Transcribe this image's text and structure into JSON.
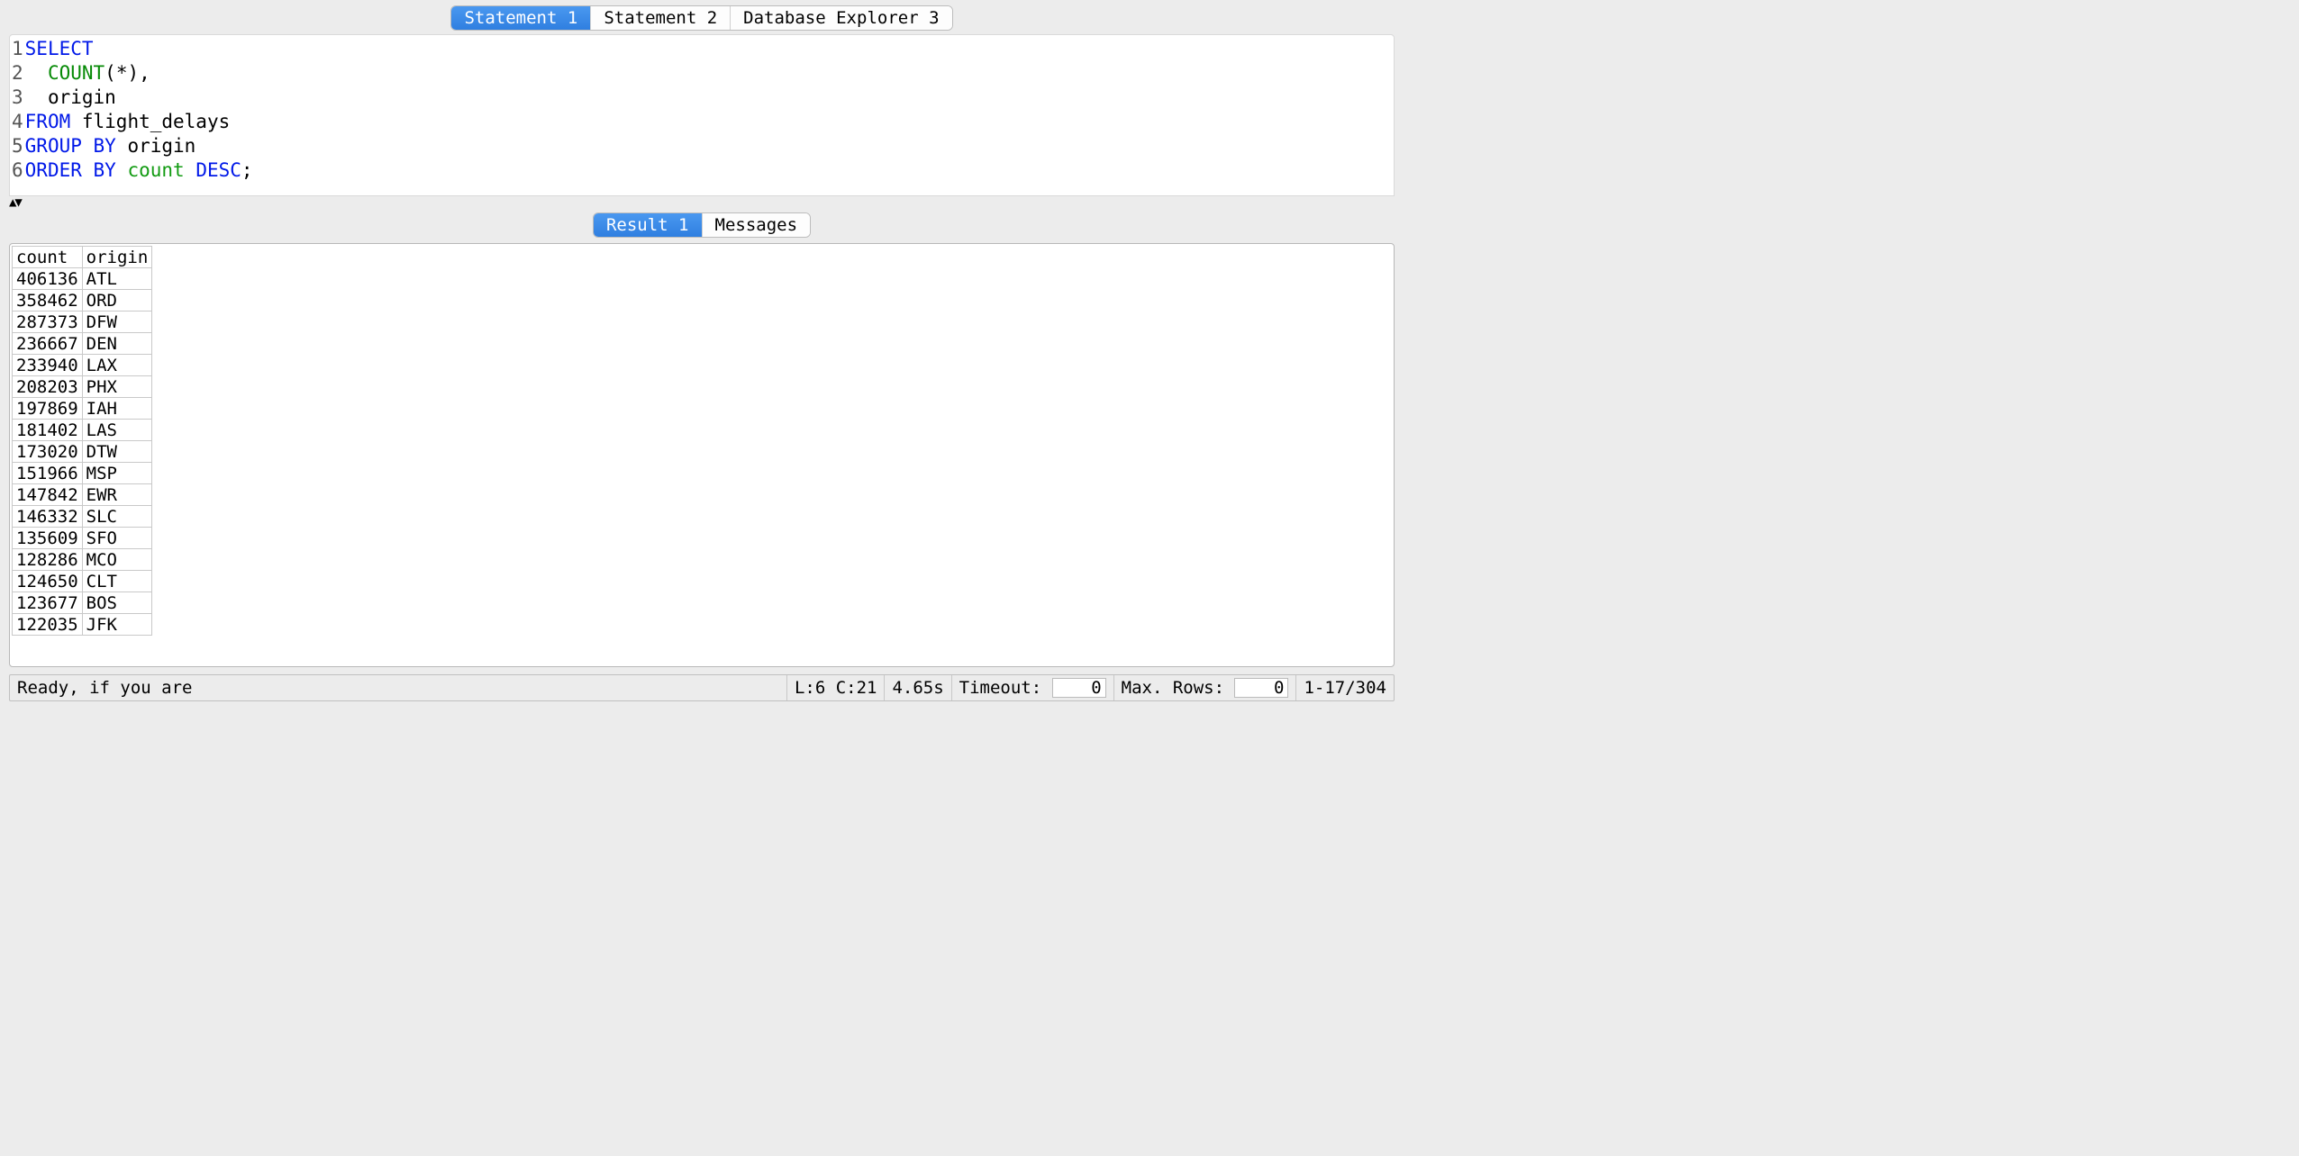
{
  "top_tabs": {
    "items": [
      {
        "label": "Statement 1",
        "active": true
      },
      {
        "label": "Statement 2",
        "active": false
      },
      {
        "label": "Database Explorer 3",
        "active": false
      }
    ]
  },
  "editor": {
    "line_numbers": [
      "1",
      "2",
      "3",
      "4",
      "5",
      "6"
    ],
    "lines": [
      [
        {
          "t": "SELECT",
          "c": "kw"
        }
      ],
      [
        {
          "t": "  ",
          "c": ""
        },
        {
          "t": "COUNT",
          "c": "fn"
        },
        {
          "t": "(*),",
          "c": ""
        }
      ],
      [
        {
          "t": "  origin",
          "c": ""
        }
      ],
      [
        {
          "t": "FROM",
          "c": "kw"
        },
        {
          "t": " flight_delays",
          "c": ""
        }
      ],
      [
        {
          "t": "GROUP BY",
          "c": "kw"
        },
        {
          "t": " origin",
          "c": ""
        }
      ],
      [
        {
          "t": "ORDER BY",
          "c": "kw"
        },
        {
          "t": " ",
          "c": ""
        },
        {
          "t": "count",
          "c": "id"
        },
        {
          "t": " ",
          "c": ""
        },
        {
          "t": "DESC",
          "c": "kw"
        },
        {
          "t": ";",
          "c": ""
        }
      ]
    ]
  },
  "mid_tabs": {
    "items": [
      {
        "label": "Result 1",
        "active": true
      },
      {
        "label": "Messages",
        "active": false
      }
    ]
  },
  "result": {
    "columns": [
      "count",
      "origin"
    ],
    "rows": [
      [
        "406136",
        "ATL"
      ],
      [
        "358462",
        "ORD"
      ],
      [
        "287373",
        "DFW"
      ],
      [
        "236667",
        "DEN"
      ],
      [
        "233940",
        "LAX"
      ],
      [
        "208203",
        "PHX"
      ],
      [
        "197869",
        "IAH"
      ],
      [
        "181402",
        "LAS"
      ],
      [
        "173020",
        "DTW"
      ],
      [
        "151966",
        "MSP"
      ],
      [
        "147842",
        "EWR"
      ],
      [
        "146332",
        "SLC"
      ],
      [
        "135609",
        "SFO"
      ],
      [
        "128286",
        "MCO"
      ],
      [
        "124650",
        "CLT"
      ],
      [
        "123677",
        "BOS"
      ],
      [
        "122035",
        "JFK"
      ]
    ]
  },
  "status": {
    "ready": "Ready, if you are",
    "cursor": "L:6 C:21",
    "elapsed": "4.65s",
    "timeout_label": "Timeout:",
    "timeout_value": "0",
    "maxrows_label": "Max. Rows:",
    "maxrows_value": "0",
    "range": "1-17/304"
  }
}
